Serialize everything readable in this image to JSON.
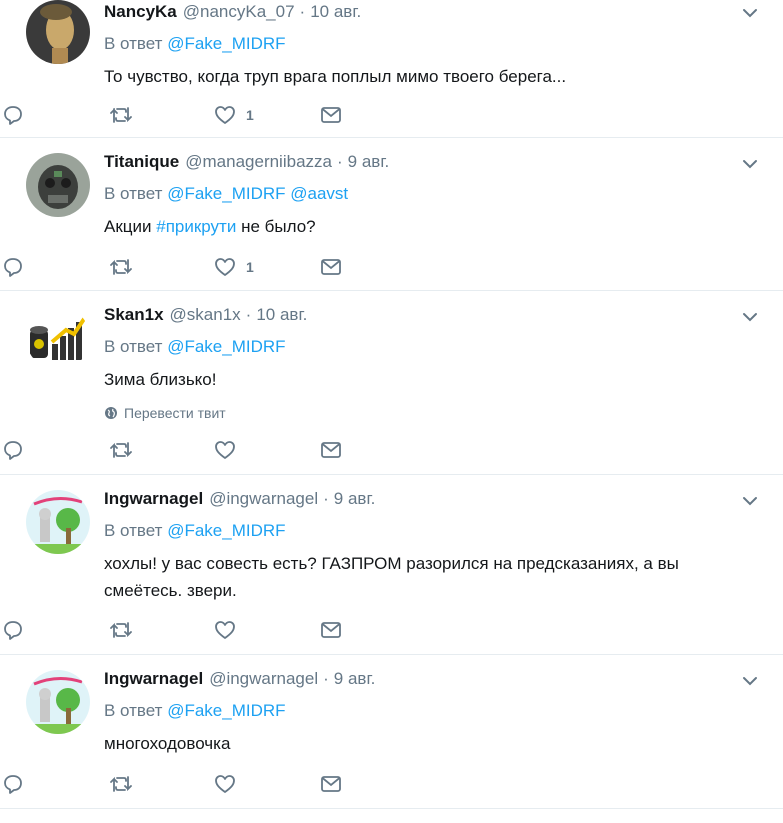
{
  "reply_prefix": "В ответ",
  "translate_label": "Перевести твит",
  "tweets": [
    {
      "name": "NancyKa",
      "handle": "@nancyKa_07",
      "dot": "·",
      "date": "10 авг.",
      "mentions": [
        "@Fake_MIDRF"
      ],
      "text_parts": [
        {
          "t": "То чувство, когда труп врага поплыл мимо твоего берега..."
        }
      ],
      "likes": "1",
      "translate": false
    },
    {
      "name": "Titanique",
      "handle": "@managerniibazza",
      "dot": "·",
      "date": "9 авг.",
      "mentions": [
        "@Fake_MIDRF",
        "@aavst"
      ],
      "text_parts": [
        {
          "t": "Акции "
        },
        {
          "t": "#прикрути",
          "tag": true
        },
        {
          "t": " не было?"
        }
      ],
      "likes": "1",
      "translate": false
    },
    {
      "name": "Skan1x",
      "handle": "@skan1x",
      "dot": "·",
      "date": "10 авг.",
      "mentions": [
        "@Fake_MIDRF"
      ],
      "text_parts": [
        {
          "t": "Зима близько!"
        }
      ],
      "likes": "",
      "translate": true
    },
    {
      "name": "Ingwarnagel",
      "handle": "@ingwarnagel",
      "dot": "·",
      "date": "9 авг.",
      "mentions": [
        "@Fake_MIDRF"
      ],
      "text_parts": [
        {
          "t": "хохлы! у вас совесть есть? ГАЗПРОМ разорился на предсказаниях, а вы смеётесь. звери."
        }
      ],
      "likes": "",
      "translate": false
    },
    {
      "name": "Ingwarnagel",
      "handle": "@ingwarnagel",
      "dot": "·",
      "date": "9 авг.",
      "mentions": [
        "@Fake_MIDRF"
      ],
      "text_parts": [
        {
          "t": "многоходовочка"
        }
      ],
      "likes": "",
      "translate": false
    }
  ],
  "colors": {
    "link": "#1da1f2",
    "muted": "#657786",
    "text": "#14171a",
    "border": "#e6ecf0"
  },
  "icons": [
    "reply-icon",
    "retweet-icon",
    "like-icon",
    "direct-message-icon",
    "chevron-down-icon",
    "globe-icon"
  ]
}
